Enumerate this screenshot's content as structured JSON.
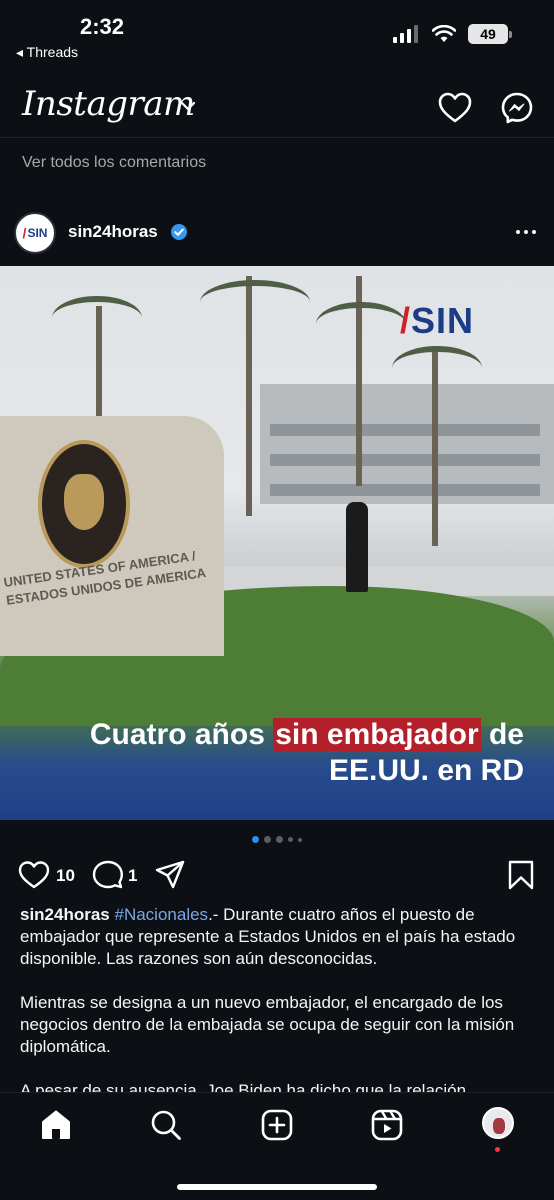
{
  "status_bar": {
    "time": "2:32",
    "back_app": "◂ Threads",
    "battery": "49"
  },
  "header": {
    "logo": "Instagram",
    "icons": [
      "heart-icon",
      "messenger-icon",
      "chevron-down-icon"
    ]
  },
  "view_all_comments": "Ver todos los comentarios",
  "post": {
    "username": "sin24horas",
    "verified": true,
    "image": {
      "brand_logo": "SIN",
      "wall_text": "UNITED STATES OF AMERICA / ESTADOS UNIDOS DE AMERICA",
      "headline_pre": "Cuatro años ",
      "headline_highlight": "sin embajador",
      "headline_post": " de",
      "headline_line2": "EE.UU. en RD"
    },
    "carousel": {
      "count": 5,
      "active_index": 0
    },
    "likes": "10",
    "comments": "1",
    "caption": {
      "user": "sin24horas",
      "hashtag": "#Nacionales",
      "p1": ".- Durante cuatro años el puesto de embajador que represente a Estados Unidos en el país ha estado disponible. Las razones son aún desconocidas.",
      "p2": "Mientras se designa a un nuevo embajador, el encargado de los negocios dentro de la embajada se ocupa de seguir con la misión diplomática.",
      "p3": "A pesar de su ausencia, Joe Biden ha dicho que la relación"
    }
  },
  "bottom_nav": {
    "items": [
      "home-icon",
      "search-icon",
      "create-icon",
      "reels-icon",
      "profile-avatar"
    ]
  },
  "colors": {
    "background": "#0c1014",
    "highlight_red": "#b3202a",
    "hashtag_blue": "#7aa6e6",
    "active_dot": "#2f8ef3"
  }
}
